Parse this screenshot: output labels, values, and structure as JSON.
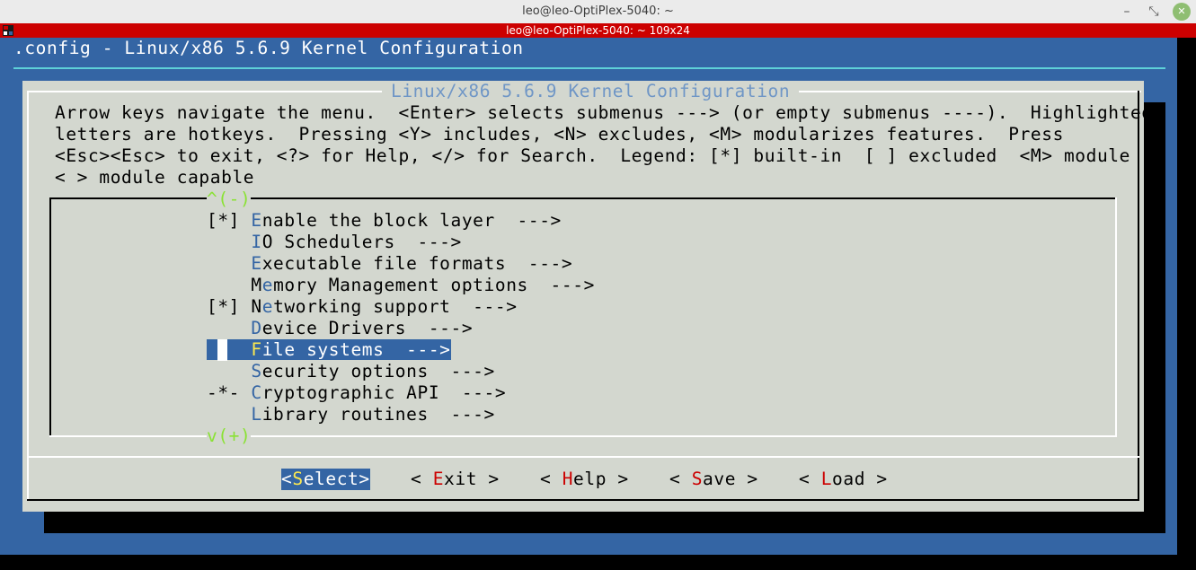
{
  "window": {
    "title": "leo@leo-OptiPlex-5040: ~",
    "minimize_icon": "minimize-icon",
    "restore_icon": "restore-icon",
    "close_icon": "close-icon"
  },
  "terminal": {
    "title": "leo@leo-OptiPlex-5040: ~ 109x24",
    "icon": "terminal-icon"
  },
  "menuconfig": {
    "file_title": ".config - Linux/x86 5.6.9 Kernel Configuration",
    "dialog_title": "Linux/x86 5.6.9 Kernel Configuration",
    "help_lines": [
      "Arrow keys navigate the menu.  <Enter> selects submenus ---> (or empty submenus ----).  Highlighted",
      "letters are hotkeys.  Pressing <Y> includes, <N> excludes, <M> modularizes features.  Press",
      "<Esc><Esc> to exit, <?> for Help, </> for Search.  Legend: [*] built-in  [ ] excluded  <M> module",
      "< > module capable"
    ],
    "scroll_up": "^(-)",
    "scroll_down": "v(+)",
    "items": [
      {
        "prefix": "[*] ",
        "pre": "",
        "hotkey": "E",
        "rest": "nable the block layer  --->"
      },
      {
        "prefix": "    ",
        "pre": "",
        "hotkey": "I",
        "rest": "O Schedulers  --->"
      },
      {
        "prefix": "    ",
        "pre": "",
        "hotkey": "E",
        "rest": "xecutable file formats  --->"
      },
      {
        "prefix": "    ",
        "pre": "M",
        "hotkey": "e",
        "rest": "mory Management options  --->"
      },
      {
        "prefix": "[*] ",
        "pre": "N",
        "hotkey": "e",
        "rest": "tworking support  --->"
      },
      {
        "prefix": "    ",
        "pre": "",
        "hotkey": "D",
        "rest": "evice Drivers  --->"
      },
      {
        "prefix": "    ",
        "pre": "",
        "hotkey": "F",
        "rest": "ile systems  --->"
      },
      {
        "prefix": "    ",
        "pre": "",
        "hotkey": "S",
        "rest": "ecurity options  --->"
      },
      {
        "prefix": "-*- ",
        "pre": "",
        "hotkey": "C",
        "rest": "ryptographic API  --->"
      },
      {
        "prefix": "    ",
        "pre": "",
        "hotkey": "L",
        "rest": "ibrary routines  --->"
      }
    ],
    "selected_index": 6,
    "buttons": [
      {
        "open": "<",
        "hotkey": "S",
        "rest": "elect",
        "close": ">"
      },
      {
        "open": "< ",
        "hotkey": "E",
        "rest": "xit",
        "close": " >"
      },
      {
        "open": "< ",
        "hotkey": "H",
        "rest": "elp",
        "close": " >"
      },
      {
        "open": "< ",
        "hotkey": "S",
        "rest": "ave",
        "close": " >"
      },
      {
        "open": "< ",
        "hotkey": "L",
        "rest": "oad",
        "close": " >"
      }
    ],
    "colors": {
      "terminal_blue": "#3465a4",
      "dialog_gray": "#d3d7cf",
      "hotkey_blue": "#3465a4",
      "hotkey_red": "#cc0000",
      "selected_hotkey": "#fce94f",
      "scroll_green": "#8ae234",
      "title_cyan": "#5ed1d8",
      "tabbar_red": "#cc0000"
    }
  }
}
